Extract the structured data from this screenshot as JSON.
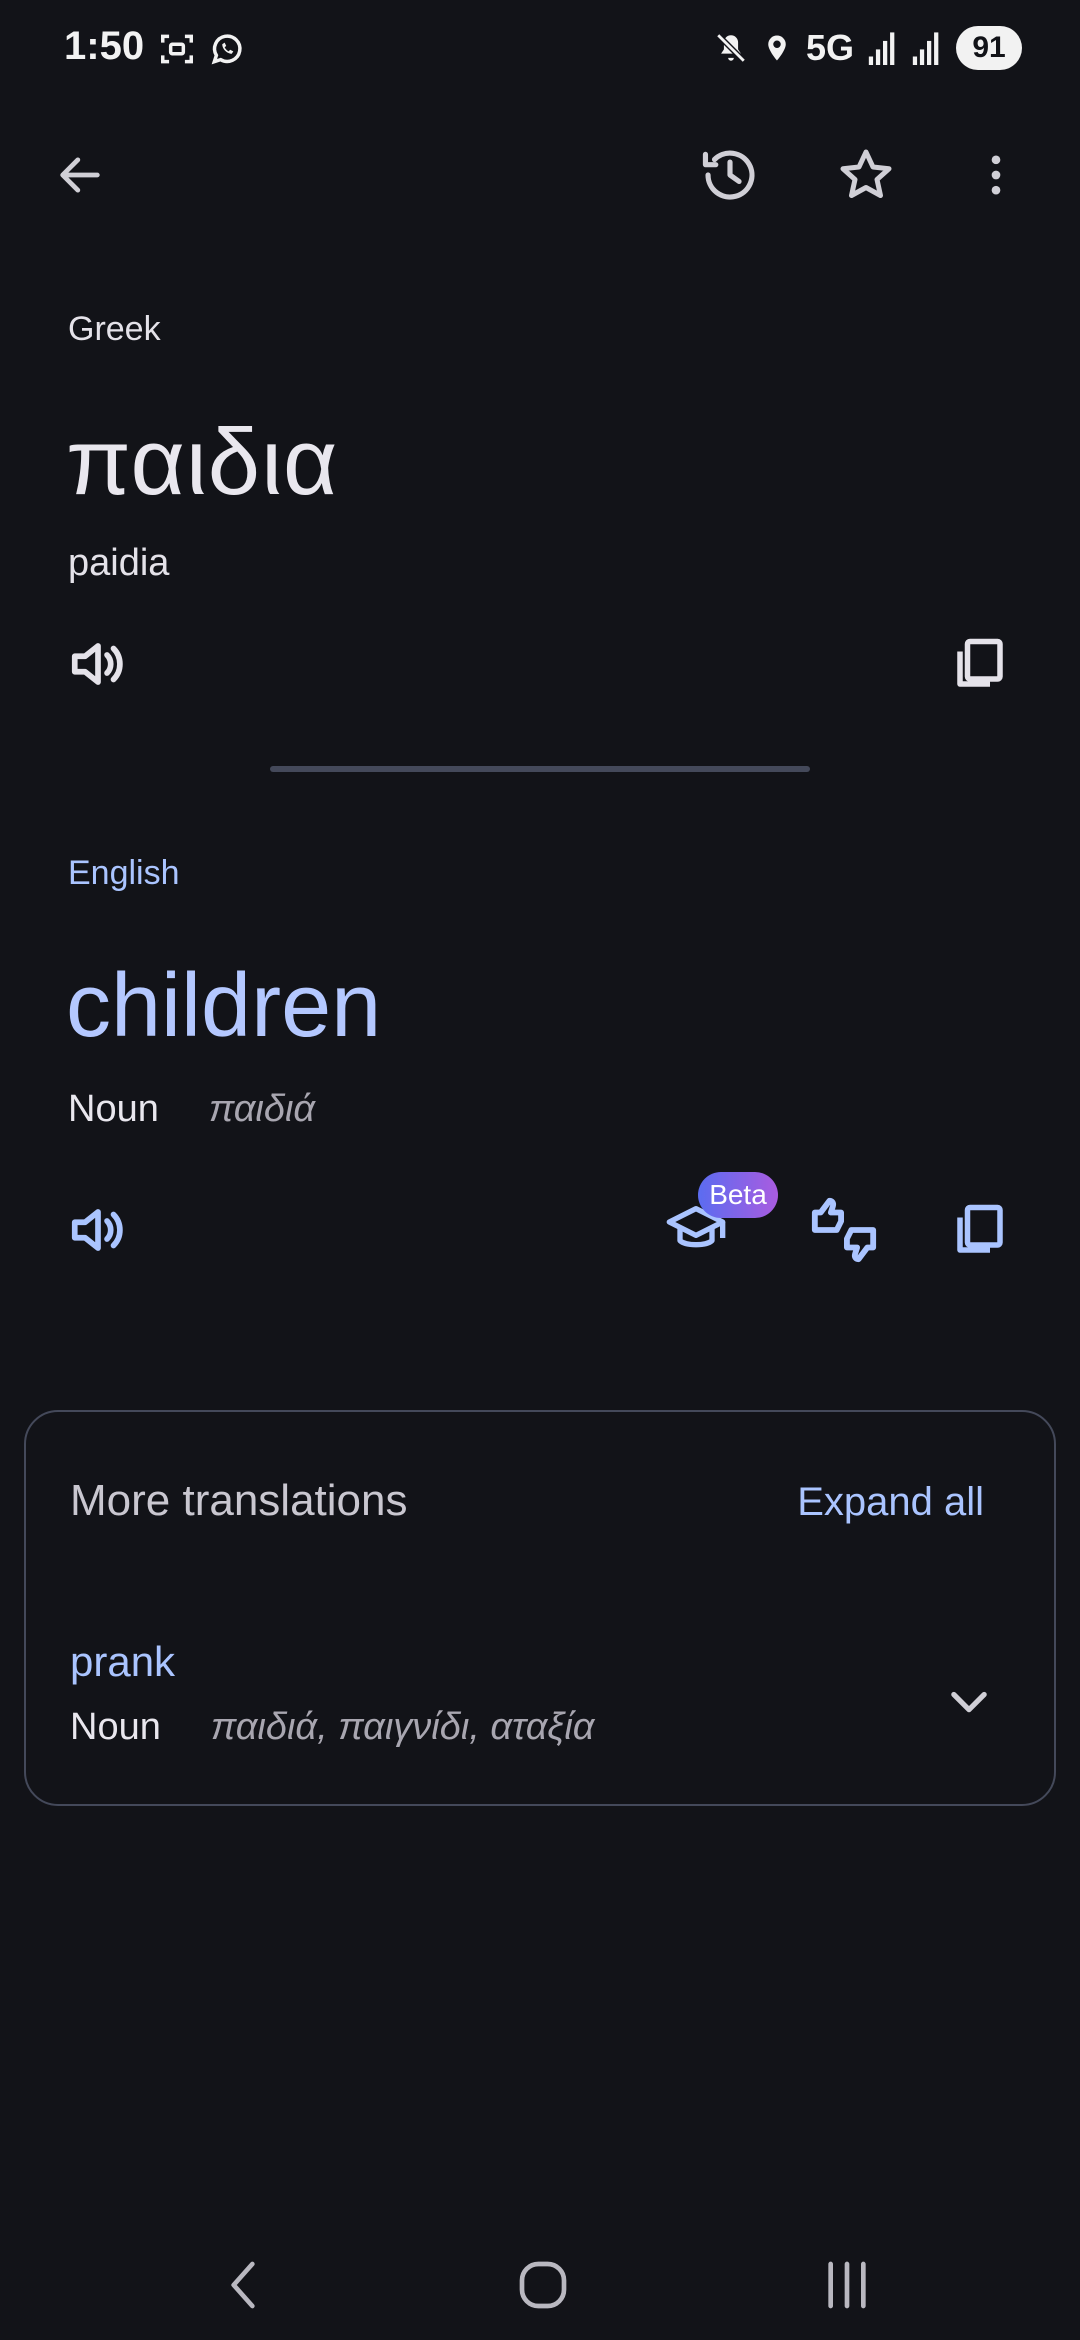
{
  "status_bar": {
    "time": "1:50",
    "network": "5G",
    "battery": "91"
  },
  "source": {
    "language": "Greek",
    "text": "παιδια",
    "transliteration": "paidia"
  },
  "target": {
    "language": "English",
    "text": "children",
    "part_of_speech": "Noun",
    "back_translation": "παιδιά",
    "beta_badge": "Beta"
  },
  "more_translations": {
    "title": "More translations",
    "expand_label": "Expand all",
    "entries": [
      {
        "word": "prank",
        "part_of_speech": "Noun",
        "back_translations": "παιδιά, παιγνίδι, αταξία"
      }
    ]
  },
  "colors": {
    "background": "#121318",
    "accent": "#aac4ff",
    "text": "#e4e2e9"
  }
}
